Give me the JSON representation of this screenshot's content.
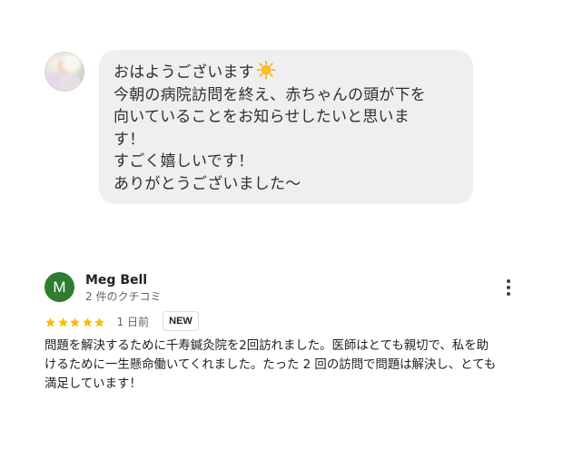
{
  "chat": {
    "lines": [
      "おはようございます",
      "今朝の病院訪問を終え、赤ちゃんの頭が下を",
      "向いていることをお知らせしたいと思いま",
      "す！",
      "すごく嬉しいです！",
      "ありがとうございました〜"
    ],
    "emoji_icon": "sun-icon"
  },
  "review": {
    "avatar_letter": "M",
    "avatar_color": "#2e7d32",
    "name": "Meg Bell",
    "meta": "2 件のクチコミ",
    "rating": 5,
    "rating_max": 5,
    "star_color": "#fbbc04",
    "date": "1 日前",
    "badge": "NEW",
    "text_lines": [
      "問題を解決するために千寿鍼灸院を2回訪れました。医師はとても親切で、私を助",
      "けるために一生懸命働いてくれました。たった 2 回の訪問で問題は解決し、とても",
      "満足しています！"
    ]
  }
}
